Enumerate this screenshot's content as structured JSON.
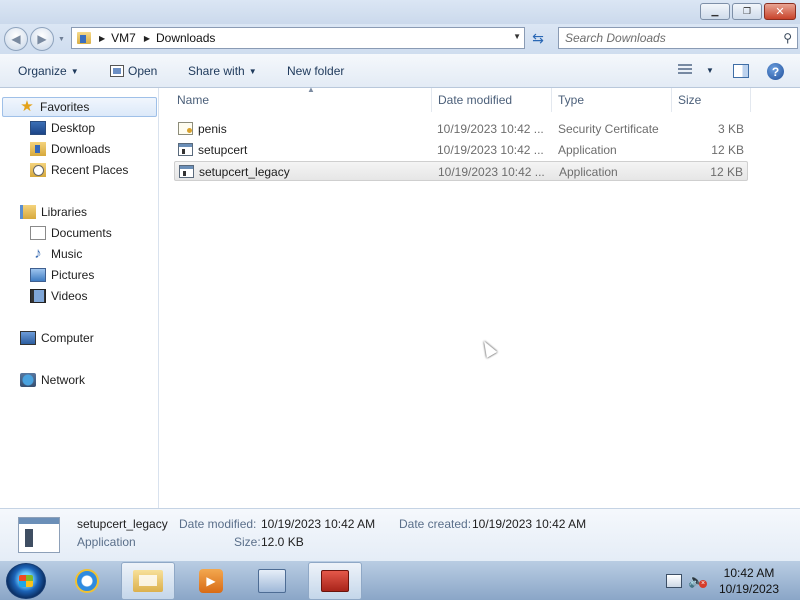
{
  "window": {
    "minimize_icon": "minimize-icon",
    "maximize_icon": "restore-icon",
    "close_icon": "close-icon"
  },
  "address": {
    "crumbs": [
      "VM7",
      "Downloads"
    ],
    "search_placeholder": "Search Downloads"
  },
  "toolbar": {
    "organize": "Organize",
    "open": "Open",
    "share_with": "Share with",
    "new_folder": "New folder"
  },
  "nav": {
    "favorites": "Favorites",
    "desktop": "Desktop",
    "downloads": "Downloads",
    "recent_places": "Recent Places",
    "libraries": "Libraries",
    "documents": "Documents",
    "music": "Music",
    "pictures": "Pictures",
    "videos": "Videos",
    "computer": "Computer",
    "network": "Network"
  },
  "columns": {
    "name": "Name",
    "date_modified": "Date modified",
    "type": "Type",
    "size": "Size"
  },
  "files": [
    {
      "name": "penis",
      "date": "10/19/2023 10:42 ...",
      "type": "Security Certificate",
      "size": "3 KB",
      "icon": "certificate-icon"
    },
    {
      "name": "setupcert",
      "date": "10/19/2023 10:42 ...",
      "type": "Application",
      "size": "12 KB",
      "icon": "application-icon"
    },
    {
      "name": "setupcert_legacy",
      "date": "10/19/2023 10:42 ...",
      "type": "Application",
      "size": "12 KB",
      "icon": "application-icon"
    }
  ],
  "details": {
    "name": "setupcert_legacy",
    "kind": "Application",
    "date_modified_label": "Date modified:",
    "date_modified": "10/19/2023 10:42 AM",
    "date_created_label": "Date created:",
    "date_created": "10/19/2023 10:42 AM",
    "size_label": "Size:",
    "size": "12.0 KB"
  },
  "taskbar": {
    "time": "10:42 AM",
    "date": "10/19/2023"
  }
}
